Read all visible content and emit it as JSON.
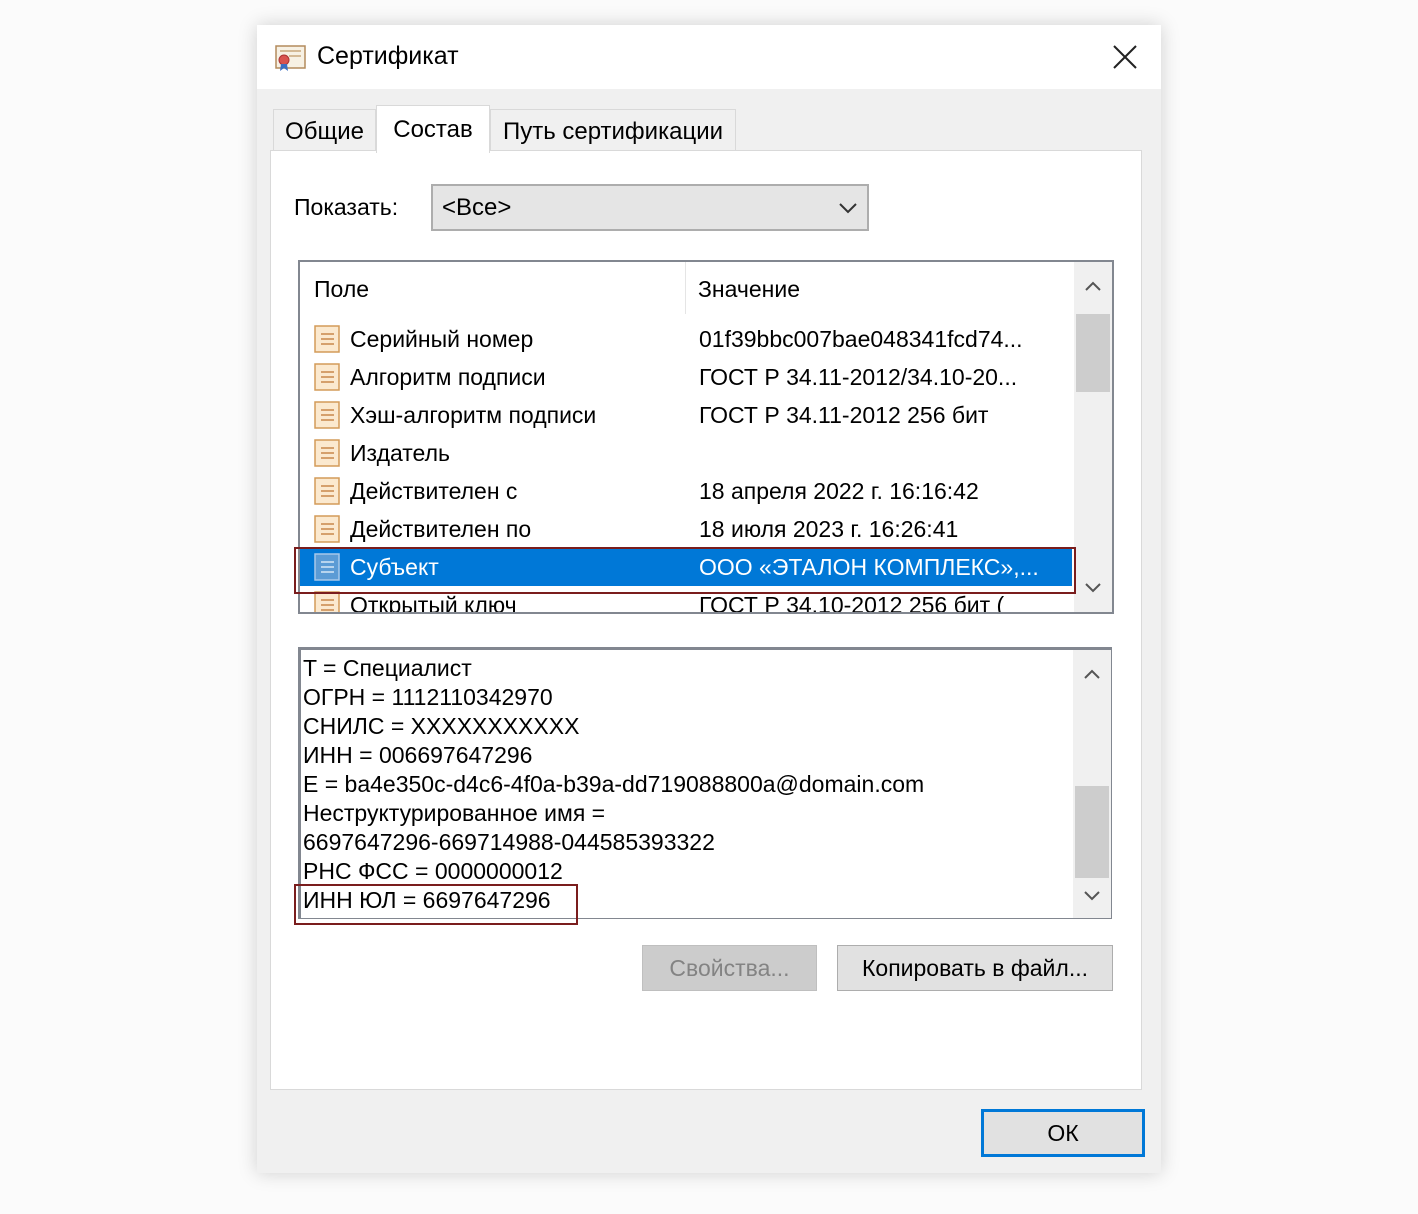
{
  "window": {
    "title": "Сертификат"
  },
  "tabs": [
    {
      "label": "Общие",
      "active": false
    },
    {
      "label": "Состав",
      "active": true
    },
    {
      "label": "Путь сертификации",
      "active": false
    }
  ],
  "filter": {
    "label": "Показать:",
    "selected": "<Все>"
  },
  "fields_table": {
    "columns": [
      "Поле",
      "Значение"
    ],
    "rows": [
      {
        "field": "Серийный номер",
        "value": "01f39bbc007bae048341fcd74...",
        "selected": false
      },
      {
        "field": "Алгоритм подписи",
        "value": "ГОСТ Р 34.11-2012/34.10-20...",
        "selected": false
      },
      {
        "field": "Хэш-алгоритм подписи",
        "value": "ГОСТ Р 34.11-2012 256 бит",
        "selected": false
      },
      {
        "field": "Издатель",
        "value": "",
        "selected": false
      },
      {
        "field": "Действителен с",
        "value": "18 апреля 2022 г. 16:16:42",
        "selected": false
      },
      {
        "field": "Действителен по",
        "value": "18 июля 2023 г. 16:26:41",
        "selected": false
      },
      {
        "field": "Субъект",
        "value": "ООО «ЭТАЛОН КОМПЛЕКС»,...",
        "selected": true
      },
      {
        "field": "Открытый ключ",
        "value": "ГОСТ Р 34.10-2012 256 бит (",
        "selected": false
      }
    ]
  },
  "details": {
    "lines": [
      "T = Специалист",
      "ОГРН = 1112110342970",
      "СНИЛС = XXXXXXXXXXX",
      "ИНН = 006697647296",
      "E = ba4e350c-d4c6-4f0a-b39a-dd719088800a@domain.com",
      "Неструктурированное имя =",
      "6697647296-669714988-044585393322",
      "РНС ФСС = 0000000012",
      "ИНН ЮЛ = 6697647296"
    ]
  },
  "buttons": {
    "properties": "Свойства...",
    "copy_to_file": "Копировать в файл...",
    "ok": "ОК"
  },
  "colors": {
    "selection": "#0078d7",
    "highlight_frame": "#7a1d1d"
  }
}
